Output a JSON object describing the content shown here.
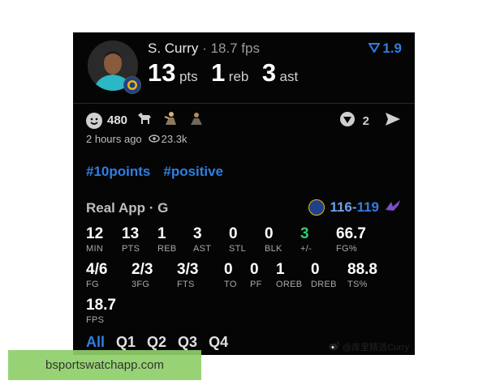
{
  "post": {
    "player_name": "S. Curry",
    "separator": "·",
    "fps": "18.7 fps",
    "vote_score": "1.9",
    "points": "13",
    "points_label": "pts",
    "rebounds": "1",
    "rebounds_label": "reb",
    "assists": "3",
    "assists_label": "ast"
  },
  "reactions": {
    "count": "480",
    "comments": "2",
    "time_ago": "2 hours ago",
    "views": "23.3k"
  },
  "tags": [
    "#10points",
    "#positive"
  ],
  "game": {
    "title": "Real App · G",
    "score_left": "116",
    "score_dash": "-",
    "score_right": "119"
  },
  "stats": [
    {
      "value": "12",
      "label": "MIN"
    },
    {
      "value": "13",
      "label": "PTS"
    },
    {
      "value": "1",
      "label": "REB"
    },
    {
      "value": "3",
      "label": "AST"
    },
    {
      "value": "0",
      "label": "STL"
    },
    {
      "value": "0",
      "label": "BLK"
    },
    {
      "value": "3",
      "label": "+/-"
    },
    {
      "value": "66.7",
      "label": "FG%"
    },
    {
      "value": "4/6",
      "label": "FG"
    },
    {
      "value": "2/3",
      "label": "3FG"
    },
    {
      "value": "3/3",
      "label": "FTS"
    },
    {
      "value": "0",
      "label": "TO"
    },
    {
      "value": "0",
      "label": "PF"
    },
    {
      "value": "1",
      "label": "OREB"
    },
    {
      "value": "0",
      "label": "DREB"
    },
    {
      "value": "88.8",
      "label": "TS%"
    },
    {
      "value": "18.7",
      "label": "FPS"
    }
  ],
  "tabs": [
    "All",
    "Q1",
    "Q2",
    "Q3",
    "Q4"
  ],
  "weibo_credit": "@库里精选Curry",
  "watermark": "bsportswatchapp.com",
  "colors": {
    "accent": "#2f7fe0",
    "positive": "#2ecc71",
    "background": "#050505"
  }
}
